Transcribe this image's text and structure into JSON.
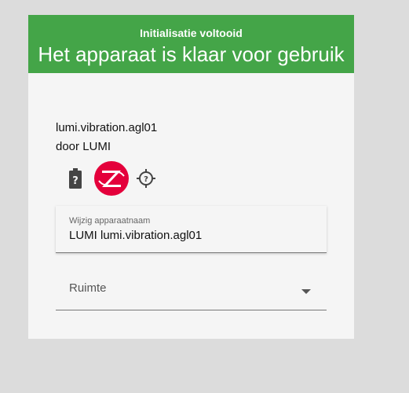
{
  "header": {
    "subtitle": "Initialisatie voltooid",
    "title": "Het apparaat is klaar voor gebruik",
    "color": "#44a548"
  },
  "device": {
    "model": "lumi.vibration.agl01",
    "manufacturer": "door LUMI",
    "icons": [
      "battery-unknown-icon",
      "zigbee-icon",
      "lqi-unknown-icon"
    ]
  },
  "name_field": {
    "label": "Wijzig apparaatnaam",
    "value": "LUMI lumi.vibration.agl01"
  },
  "room_field": {
    "label": "Ruimte"
  },
  "colors": {
    "zigbee": "#e4003b",
    "icon": "#444444"
  }
}
